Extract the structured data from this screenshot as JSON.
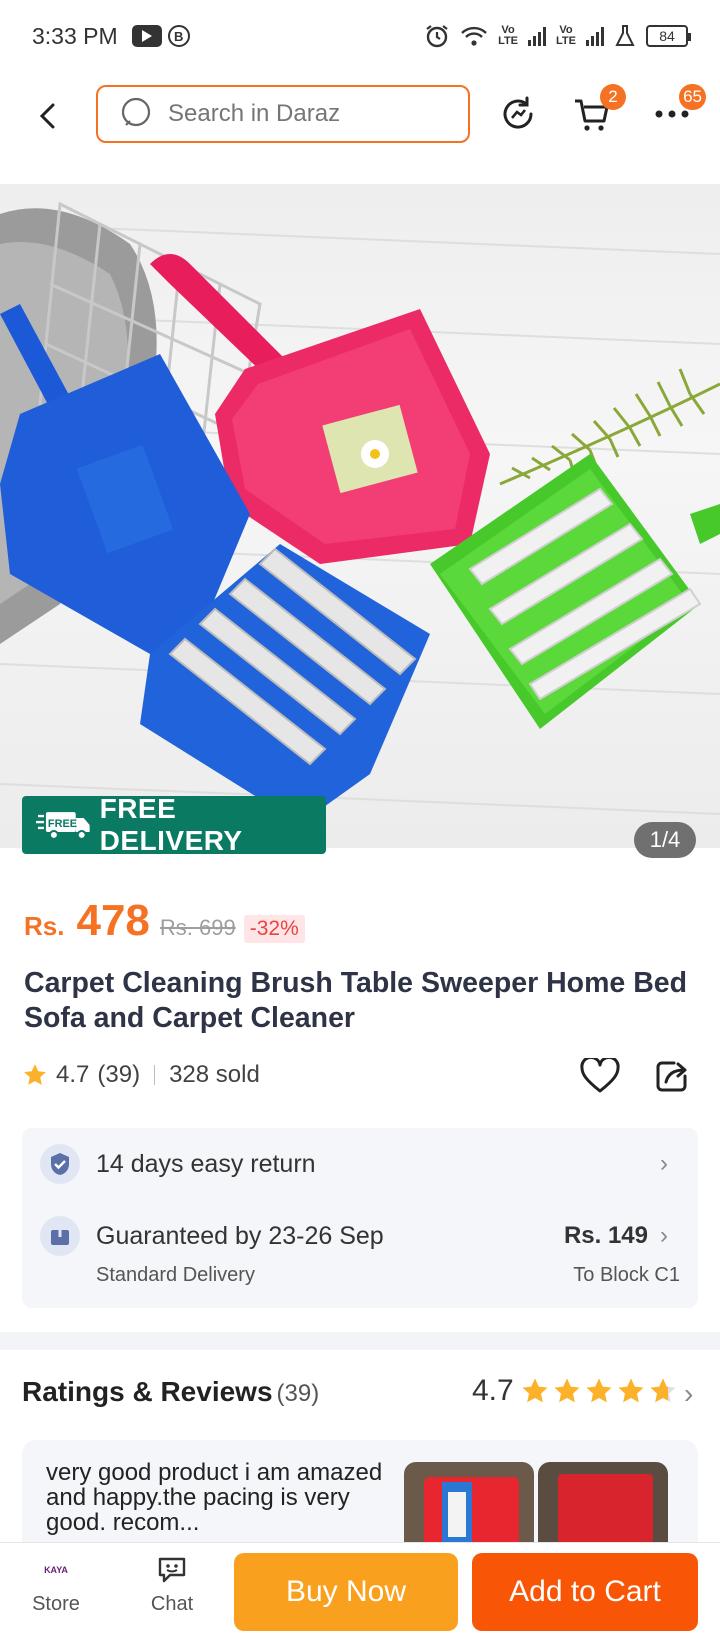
{
  "status_bar": {
    "time": "3:33 PM",
    "battery": "84",
    "network_label": "Vo LTE"
  },
  "nav": {
    "search_placeholder": "Search in Daraz",
    "cart_badge": "2",
    "more_badge": "65"
  },
  "gallery": {
    "free_delivery_tag": "FREE",
    "free_delivery": "FREE DELIVERY",
    "counter": "1/4"
  },
  "price": {
    "currency": "Rs.",
    "current": "478",
    "original": "Rs. 699",
    "discount": "-32%"
  },
  "product": {
    "title": "Carpet Cleaning Brush Table Sweeper Home Bed Sofa and Carpet Cleaner",
    "rating": "4.7",
    "rating_count": "(39)",
    "sold": "328 sold"
  },
  "service": {
    "return_text": "14 days easy return",
    "delivery_text": "Guaranteed by 23-26 Sep",
    "delivery_type": "Standard Delivery",
    "delivery_fee": "Rs. 149",
    "delivery_to": "To Block C1"
  },
  "ratings": {
    "heading": "Ratings & Reviews",
    "count": "(39)",
    "score": "4.7",
    "stars": 4.7,
    "review_text": "very good product i am amazed and happy.the pacing is very good. recom..."
  },
  "bottom_bar": {
    "store_label": "Store",
    "store_logo_text": "KAYA",
    "chat_label": "Chat",
    "buy_now": "Buy Now",
    "add_to_cart": "Add to Cart"
  },
  "colors": {
    "brand_orange": "#f57224",
    "buy_now": "#f9a11f",
    "add_to_cart": "#f85606",
    "free_delivery": "#0a7a63",
    "star": "#fbb12a"
  }
}
